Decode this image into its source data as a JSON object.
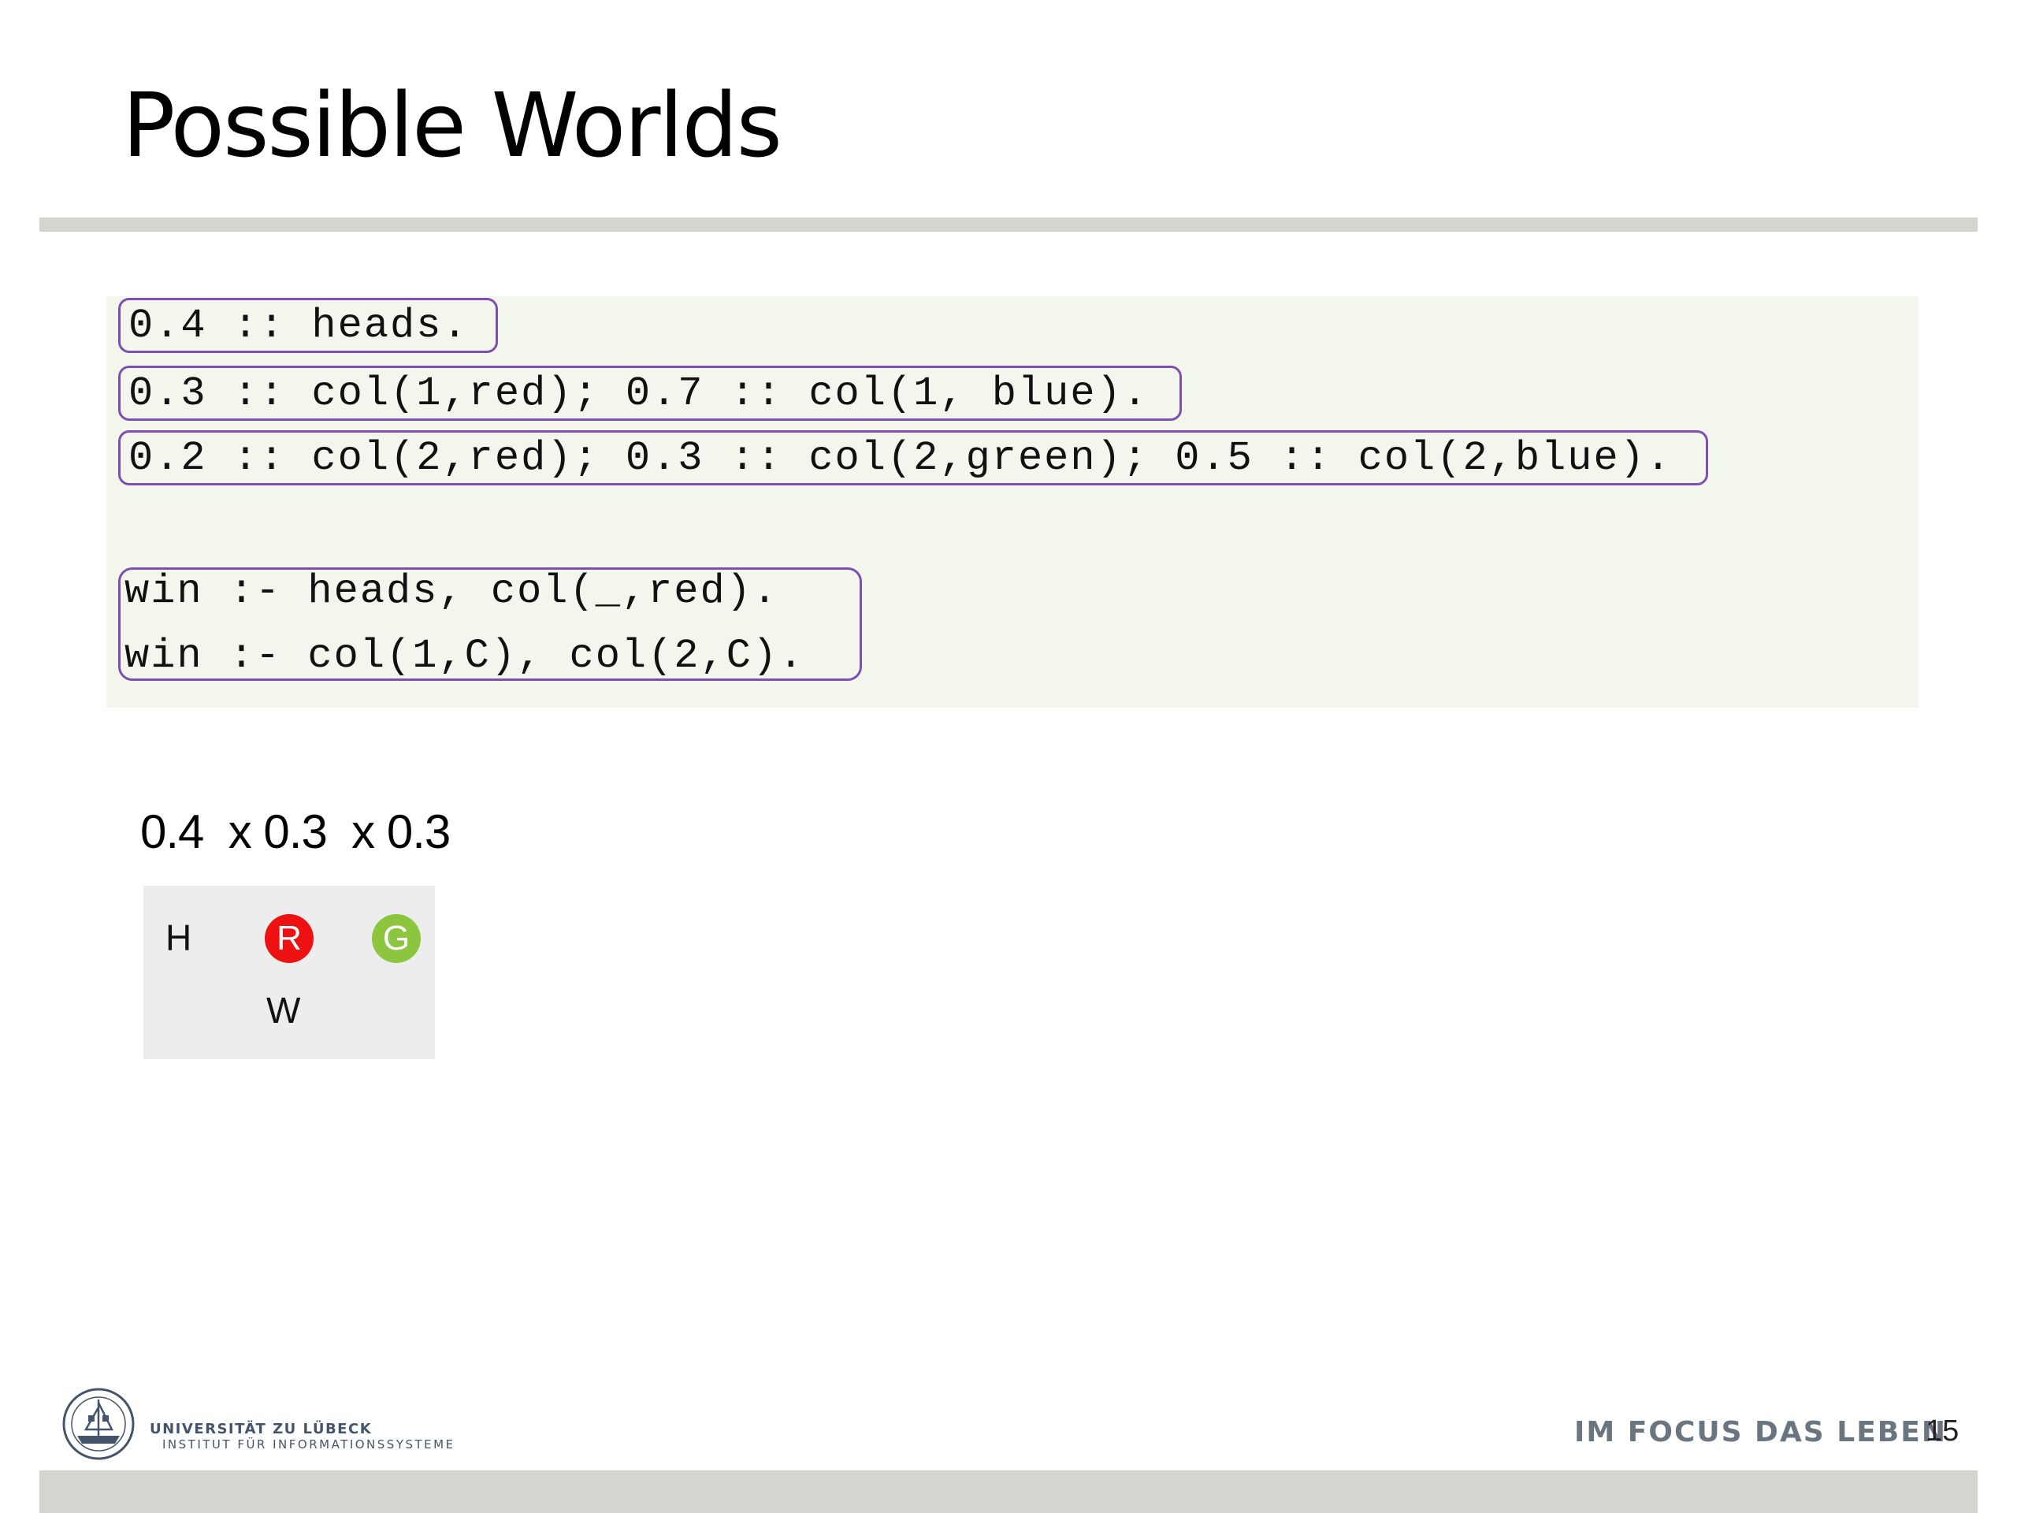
{
  "slide": {
    "title": "Possible Worlds",
    "page_number": "15"
  },
  "code": {
    "facts": [
      "0.4 :: heads.",
      "0.3 :: col(1,red); 0.7 :: col(1, blue).",
      "0.2 :: col(2,red); 0.3 :: col(2,green); 0.5 :: col(2,blue)."
    ],
    "rules": [
      "win :- heads, col(_,red).",
      "win :- col(1,C), col(2,C)."
    ]
  },
  "probability": {
    "text": "0.4  x 0.3  x 0.3"
  },
  "world": {
    "heads_label": "H",
    "red_label": "R",
    "green_label": "G",
    "win_label": "W",
    "red_color": "#ee1111",
    "green_color": "#8cc63f"
  },
  "footer": {
    "university": "UNIVERSITÄT ZU LÜBECK",
    "institute": "INSTITUT FÜR INFORMATIONSSYSTEME",
    "slogan": "IM FOCUS DAS LEBEN"
  },
  "colors": {
    "box_border": "#7e4fb0",
    "code_background": "#f2f6ec",
    "rule_gray": "#d5d5d0"
  }
}
